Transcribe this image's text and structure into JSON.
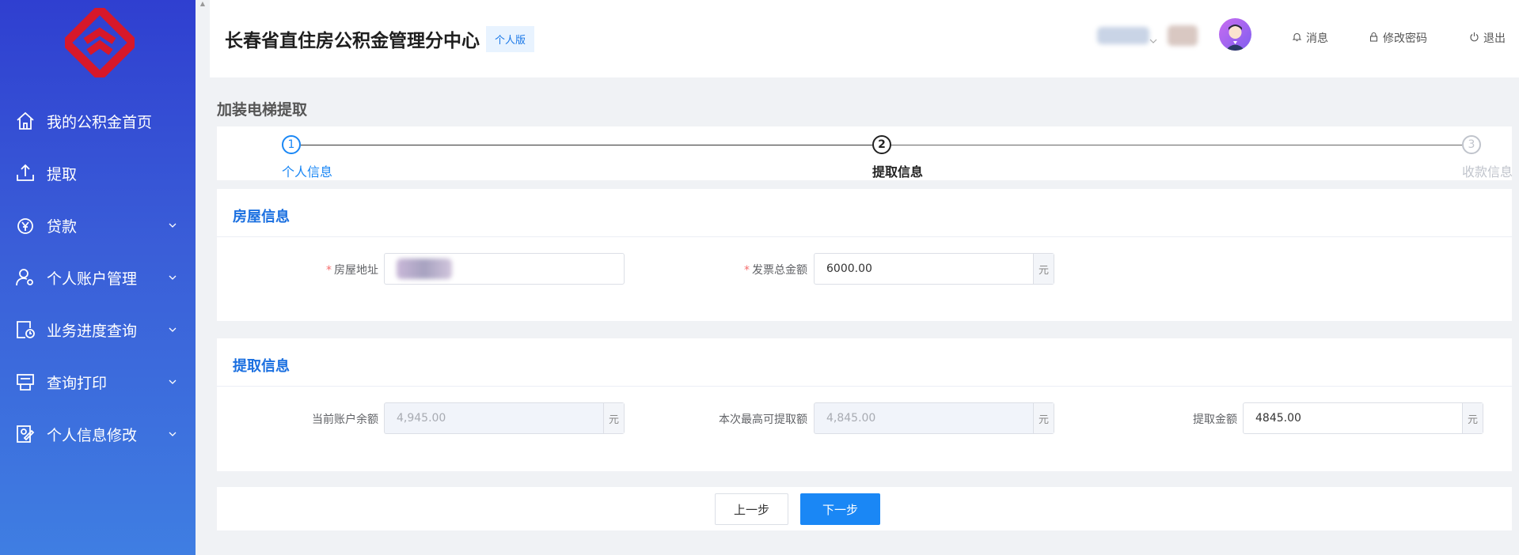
{
  "sidebar": {
    "logo": "logo-icon",
    "items": [
      {
        "label": "我的公积金首页",
        "icon": "home-icon",
        "has_submenu": false
      },
      {
        "label": "提取",
        "icon": "upload-icon",
        "has_submenu": false
      },
      {
        "label": "贷款",
        "icon": "yen-bag-icon",
        "has_submenu": true
      },
      {
        "label": "个人账户管理",
        "icon": "user-settings-icon",
        "has_submenu": true
      },
      {
        "label": "业务进度查询",
        "icon": "progress-clock-icon",
        "has_submenu": true
      },
      {
        "label": "查询打印",
        "icon": "printer-icon",
        "has_submenu": true
      },
      {
        "label": "个人信息修改",
        "icon": "edit-user-icon",
        "has_submenu": true
      }
    ]
  },
  "header": {
    "title": "长春省直住房公积金管理分中心",
    "version_badge": "个人版",
    "links": {
      "messages": "消息",
      "change_password": "修改密码",
      "logout": "退出"
    }
  },
  "page": {
    "title": "加装电梯提取"
  },
  "steps": [
    {
      "number": "1",
      "label": "个人信息",
      "state": "done"
    },
    {
      "number": "2",
      "label": "提取信息",
      "state": "active"
    },
    {
      "number": "3",
      "label": "收款信息",
      "state": "pending"
    }
  ],
  "house_info": {
    "section_title": "房屋信息",
    "address_label": "房屋地址",
    "address_value": "",
    "invoice_label": "发票总金额",
    "invoice_value": "6000.00",
    "unit": "元"
  },
  "withdraw_info": {
    "section_title": "提取信息",
    "balance_label": "当前账户余额",
    "balance_value": "4,945.00",
    "max_label": "本次最高可提取额",
    "max_value": "4,845.00",
    "amount_label": "提取金额",
    "amount_value": "4845.00",
    "unit": "元"
  },
  "actions": {
    "prev": "上一步",
    "next": "下一步"
  },
  "colors": {
    "accent": "#1a87f5",
    "section_title": "#1a6fe0",
    "sidebar_top": "#2f3fd0",
    "sidebar_bottom": "#3f7ee2",
    "required": "#f56c6c"
  }
}
